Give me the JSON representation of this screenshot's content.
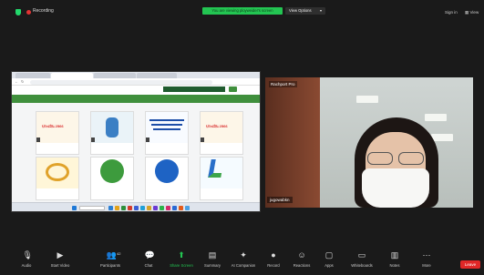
{
  "topbar": {
    "recording_label": "Recording",
    "share_banner": "You are viewing ployweider's screen",
    "view_options_label": "View Options",
    "signin_label": "Sign in",
    "view_label": "View"
  },
  "shared_screen": {
    "tabs": [
      "",
      "",
      "",
      ""
    ],
    "url": "",
    "site_brand": "",
    "site_brand2": "",
    "tooltip": "",
    "green_bar_title": "",
    "green_bar_tag": "",
    "content_left_label": "",
    "content_right_label": "",
    "cards": [
      {
        "headline": "ประเมิน 2566",
        "tag": "",
        "caption": ""
      },
      {
        "headline": "",
        "tag": "",
        "caption": ""
      },
      {
        "headline": "",
        "tag": "",
        "caption": ""
      },
      {
        "headline": "ประเมิน 2566",
        "tag": "",
        "caption": ""
      },
      {
        "headline": "",
        "tag": "",
        "caption": ""
      },
      {
        "headline": "",
        "tag": "",
        "caption": ""
      },
      {
        "headline": "",
        "tag": "",
        "caption": ""
      },
      {
        "headline": "",
        "tag": "",
        "caption": ""
      }
    ]
  },
  "video": {
    "top_label": "Rachport Pro",
    "participant_name": "jugowabkn"
  },
  "toolbar": {
    "items": [
      {
        "label": "Audio",
        "icon": "microphone-icon"
      },
      {
        "label": "Start Video",
        "icon": "video-camera-icon"
      },
      {
        "label": "Participants",
        "icon": "participants-icon",
        "count": "42"
      },
      {
        "label": "Chat",
        "icon": "chat-icon"
      },
      {
        "label": "Share Screen",
        "icon": "share-screen-icon"
      },
      {
        "label": "Summary",
        "icon": "summary-icon"
      },
      {
        "label": "AI Companion",
        "icon": "ai-companion-icon"
      },
      {
        "label": "Record",
        "icon": "record-icon"
      },
      {
        "label": "Reactions",
        "icon": "reactions-icon"
      },
      {
        "label": "Apps",
        "icon": "apps-icon"
      },
      {
        "label": "Whiteboards",
        "icon": "whiteboards-icon"
      },
      {
        "label": "Notes",
        "icon": "notes-icon"
      },
      {
        "label": "More",
        "icon": "more-icon"
      }
    ],
    "leave_label": "Leave"
  },
  "colors": {
    "accent_green": "#23c552",
    "leave_red": "#e02828",
    "site_green": "#3f8f3c"
  }
}
